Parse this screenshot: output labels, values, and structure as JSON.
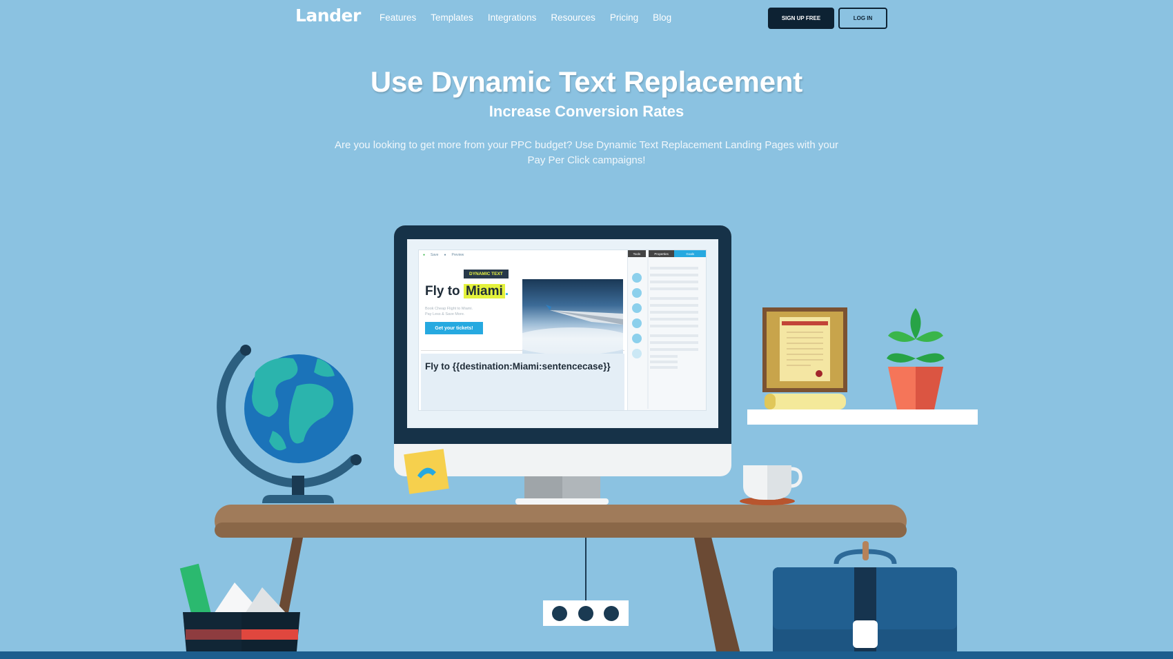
{
  "nav": {
    "logo": "Lander",
    "links": [
      "Features",
      "Templates",
      "Integrations",
      "Resources",
      "Pricing",
      "Blog"
    ],
    "signup": "SIGN UP FREE",
    "login": "LOG IN"
  },
  "hero": {
    "title": "Use Dynamic Text Replacement",
    "subtitle": "Increase Conversion Rates",
    "description": "Are you looking to get more from your PPC budget? Use Dynamic Text Replacement Landing Pages with your Pay Per Click campaigns!"
  },
  "editor": {
    "toolbar_save": "Save",
    "toolbar_preview": "Preview",
    "tag": "DYNAMIC TEXT",
    "fly": "Fly to ",
    "miami": "Miami",
    "dot": ".",
    "small_line1": "Book Cheap Flight to Miami.",
    "small_line2": "Pay Less & Save More.",
    "cta": "Get your tickets!",
    "code": "Fly to {{destination:Miami:sentencecase}}",
    "panel_tabs": [
      "Tools",
      "Properties",
      "Goals"
    ]
  },
  "colors": {
    "background": "#8bc2e1",
    "accent": "#26a9e0",
    "highlight": "#e4f23c",
    "dark": "#0d2233"
  }
}
